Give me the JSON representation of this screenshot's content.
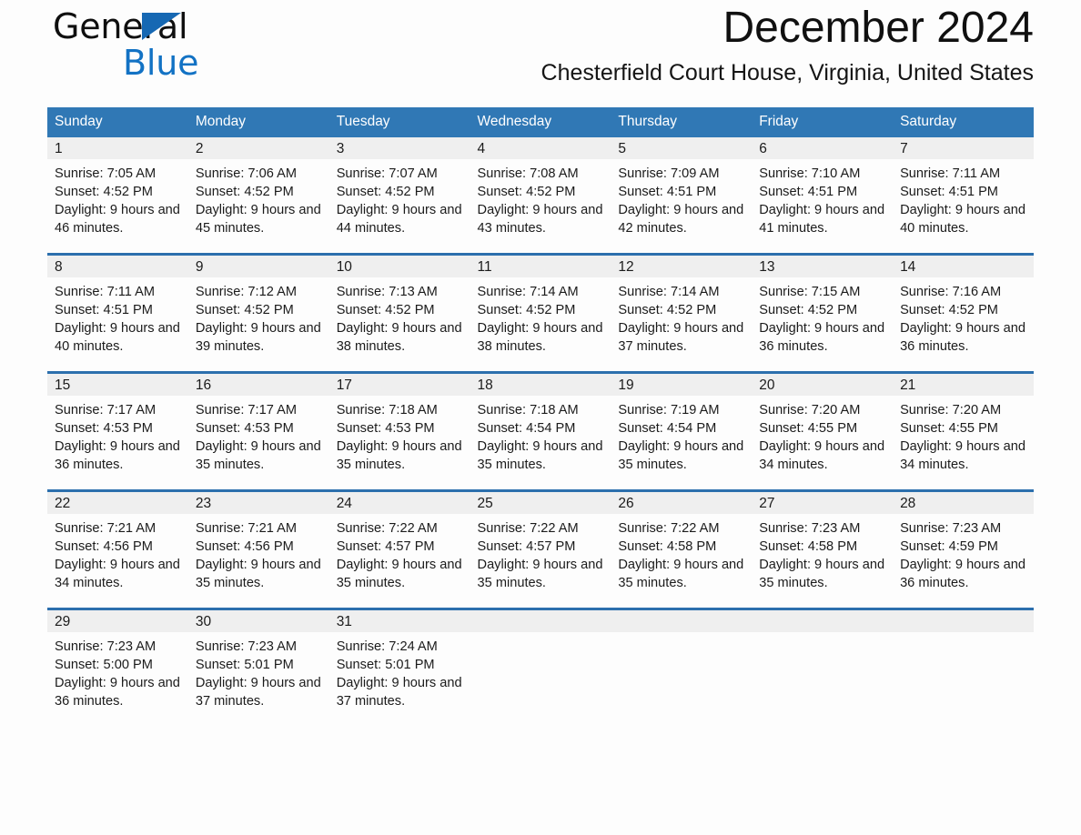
{
  "brand": {
    "name_part1": "General",
    "name_part2": "Blue",
    "accent_color": "#1272c4",
    "triangle_color": "#1668b3"
  },
  "header": {
    "title": "December 2024",
    "location": "Chesterfield Court House, Virginia, United States"
  },
  "calendar": {
    "header_bg": "#3078b5",
    "header_text_color": "#ffffff",
    "row_separator_color": "#2c6fad",
    "daynum_band_color": "#efefef",
    "weekday_headers": [
      "Sunday",
      "Monday",
      "Tuesday",
      "Wednesday",
      "Thursday",
      "Friday",
      "Saturday"
    ],
    "weeks": [
      [
        {
          "day": "1",
          "sunrise": "Sunrise: 7:05 AM",
          "sunset": "Sunset: 4:52 PM",
          "daylight": "Daylight: 9 hours and 46 minutes."
        },
        {
          "day": "2",
          "sunrise": "Sunrise: 7:06 AM",
          "sunset": "Sunset: 4:52 PM",
          "daylight": "Daylight: 9 hours and 45 minutes."
        },
        {
          "day": "3",
          "sunrise": "Sunrise: 7:07 AM",
          "sunset": "Sunset: 4:52 PM",
          "daylight": "Daylight: 9 hours and 44 minutes."
        },
        {
          "day": "4",
          "sunrise": "Sunrise: 7:08 AM",
          "sunset": "Sunset: 4:52 PM",
          "daylight": "Daylight: 9 hours and 43 minutes."
        },
        {
          "day": "5",
          "sunrise": "Sunrise: 7:09 AM",
          "sunset": "Sunset: 4:51 PM",
          "daylight": "Daylight: 9 hours and 42 minutes."
        },
        {
          "day": "6",
          "sunrise": "Sunrise: 7:10 AM",
          "sunset": "Sunset: 4:51 PM",
          "daylight": "Daylight: 9 hours and 41 minutes."
        },
        {
          "day": "7",
          "sunrise": "Sunrise: 7:11 AM",
          "sunset": "Sunset: 4:51 PM",
          "daylight": "Daylight: 9 hours and 40 minutes."
        }
      ],
      [
        {
          "day": "8",
          "sunrise": "Sunrise: 7:11 AM",
          "sunset": "Sunset: 4:51 PM",
          "daylight": "Daylight: 9 hours and 40 minutes."
        },
        {
          "day": "9",
          "sunrise": "Sunrise: 7:12 AM",
          "sunset": "Sunset: 4:52 PM",
          "daylight": "Daylight: 9 hours and 39 minutes."
        },
        {
          "day": "10",
          "sunrise": "Sunrise: 7:13 AM",
          "sunset": "Sunset: 4:52 PM",
          "daylight": "Daylight: 9 hours and 38 minutes."
        },
        {
          "day": "11",
          "sunrise": "Sunrise: 7:14 AM",
          "sunset": "Sunset: 4:52 PM",
          "daylight": "Daylight: 9 hours and 38 minutes."
        },
        {
          "day": "12",
          "sunrise": "Sunrise: 7:14 AM",
          "sunset": "Sunset: 4:52 PM",
          "daylight": "Daylight: 9 hours and 37 minutes."
        },
        {
          "day": "13",
          "sunrise": "Sunrise: 7:15 AM",
          "sunset": "Sunset: 4:52 PM",
          "daylight": "Daylight: 9 hours and 36 minutes."
        },
        {
          "day": "14",
          "sunrise": "Sunrise: 7:16 AM",
          "sunset": "Sunset: 4:52 PM",
          "daylight": "Daylight: 9 hours and 36 minutes."
        }
      ],
      [
        {
          "day": "15",
          "sunrise": "Sunrise: 7:17 AM",
          "sunset": "Sunset: 4:53 PM",
          "daylight": "Daylight: 9 hours and 36 minutes."
        },
        {
          "day": "16",
          "sunrise": "Sunrise: 7:17 AM",
          "sunset": "Sunset: 4:53 PM",
          "daylight": "Daylight: 9 hours and 35 minutes."
        },
        {
          "day": "17",
          "sunrise": "Sunrise: 7:18 AM",
          "sunset": "Sunset: 4:53 PM",
          "daylight": "Daylight: 9 hours and 35 minutes."
        },
        {
          "day": "18",
          "sunrise": "Sunrise: 7:18 AM",
          "sunset": "Sunset: 4:54 PM",
          "daylight": "Daylight: 9 hours and 35 minutes."
        },
        {
          "day": "19",
          "sunrise": "Sunrise: 7:19 AM",
          "sunset": "Sunset: 4:54 PM",
          "daylight": "Daylight: 9 hours and 35 minutes."
        },
        {
          "day": "20",
          "sunrise": "Sunrise: 7:20 AM",
          "sunset": "Sunset: 4:55 PM",
          "daylight": "Daylight: 9 hours and 34 minutes."
        },
        {
          "day": "21",
          "sunrise": "Sunrise: 7:20 AM",
          "sunset": "Sunset: 4:55 PM",
          "daylight": "Daylight: 9 hours and 34 minutes."
        }
      ],
      [
        {
          "day": "22",
          "sunrise": "Sunrise: 7:21 AM",
          "sunset": "Sunset: 4:56 PM",
          "daylight": "Daylight: 9 hours and 34 minutes."
        },
        {
          "day": "23",
          "sunrise": "Sunrise: 7:21 AM",
          "sunset": "Sunset: 4:56 PM",
          "daylight": "Daylight: 9 hours and 35 minutes."
        },
        {
          "day": "24",
          "sunrise": "Sunrise: 7:22 AM",
          "sunset": "Sunset: 4:57 PM",
          "daylight": "Daylight: 9 hours and 35 minutes."
        },
        {
          "day": "25",
          "sunrise": "Sunrise: 7:22 AM",
          "sunset": "Sunset: 4:57 PM",
          "daylight": "Daylight: 9 hours and 35 minutes."
        },
        {
          "day": "26",
          "sunrise": "Sunrise: 7:22 AM",
          "sunset": "Sunset: 4:58 PM",
          "daylight": "Daylight: 9 hours and 35 minutes."
        },
        {
          "day": "27",
          "sunrise": "Sunrise: 7:23 AM",
          "sunset": "Sunset: 4:58 PM",
          "daylight": "Daylight: 9 hours and 35 minutes."
        },
        {
          "day": "28",
          "sunrise": "Sunrise: 7:23 AM",
          "sunset": "Sunset: 4:59 PM",
          "daylight": "Daylight: 9 hours and 36 minutes."
        }
      ],
      [
        {
          "day": "29",
          "sunrise": "Sunrise: 7:23 AM",
          "sunset": "Sunset: 5:00 PM",
          "daylight": "Daylight: 9 hours and 36 minutes."
        },
        {
          "day": "30",
          "sunrise": "Sunrise: 7:23 AM",
          "sunset": "Sunset: 5:01 PM",
          "daylight": "Daylight: 9 hours and 37 minutes."
        },
        {
          "day": "31",
          "sunrise": "Sunrise: 7:24 AM",
          "sunset": "Sunset: 5:01 PM",
          "daylight": "Daylight: 9 hours and 37 minutes."
        },
        {
          "day": "",
          "sunrise": "",
          "sunset": "",
          "daylight": ""
        },
        {
          "day": "",
          "sunrise": "",
          "sunset": "",
          "daylight": ""
        },
        {
          "day": "",
          "sunrise": "",
          "sunset": "",
          "daylight": ""
        },
        {
          "day": "",
          "sunrise": "",
          "sunset": "",
          "daylight": ""
        }
      ]
    ]
  }
}
